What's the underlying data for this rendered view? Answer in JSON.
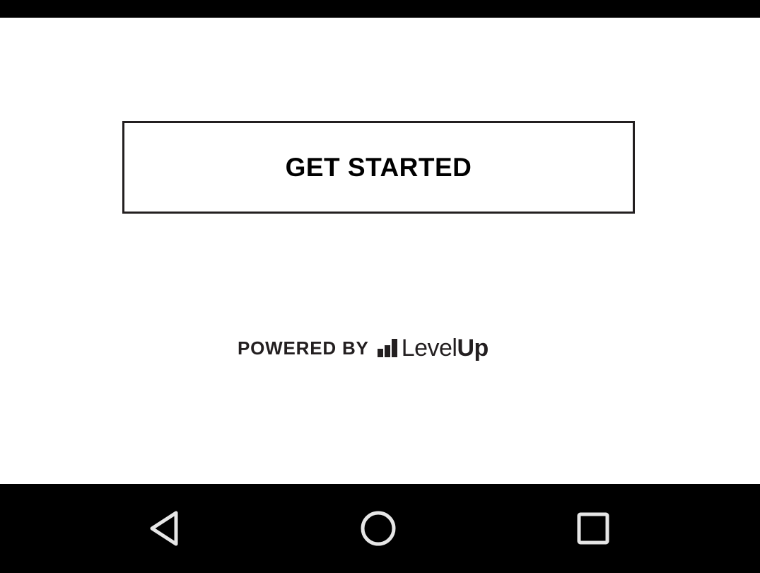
{
  "main": {
    "get_started_label": "GET STARTED"
  },
  "footer": {
    "powered_by": "POWERED BY",
    "brand_light": "Level",
    "brand_bold": "Up",
    "brand_icon": "levelup-logo-icon"
  },
  "nav_bar": {
    "buttons": [
      {
        "icon": "back-triangle-icon"
      },
      {
        "icon": "home-circle-icon"
      },
      {
        "icon": "recents-square-icon"
      }
    ]
  },
  "colors": {
    "status_bar": "#000000",
    "nav_bar": "#000000",
    "background": "#ffffff",
    "text": "#231f20",
    "nav_icon": "#e6e6e6"
  }
}
